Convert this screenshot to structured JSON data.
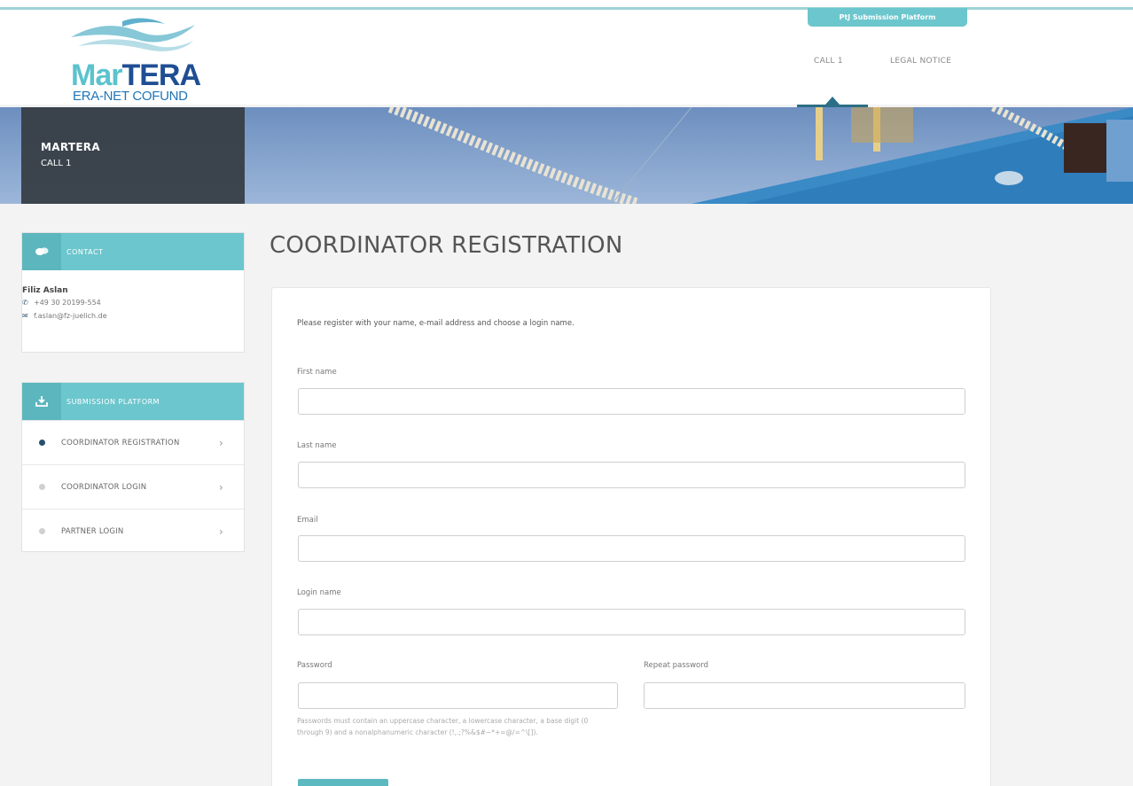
{
  "header": {
    "logo": {
      "brand_first": "Mar",
      "brand_second": "TERA",
      "subtitle": "ERA-NET COFUND"
    },
    "platform_tab": "PtJ Submission Platform",
    "nav": [
      {
        "label": "CALL 1"
      },
      {
        "label": "LEGAL NOTICE"
      }
    ]
  },
  "banner": {
    "title": "MARTERA",
    "subtitle": "CALL 1"
  },
  "sidebar": {
    "contact": {
      "heading": "CONTACT",
      "name": "Filiz Aslan",
      "phone": "+49 30 20199-554",
      "email": "f.aslan@fz-juelich.de",
      "icons": {
        "header": "chat-bubbles-icon",
        "phone": "phone-icon",
        "email": "envelope-icon"
      }
    },
    "submission": {
      "heading": "SUBMISSION PLATFORM",
      "icon": "download-tray-icon",
      "items": [
        {
          "label": "COORDINATOR REGISTRATION",
          "active": true
        },
        {
          "label": "COORDINATOR LOGIN",
          "active": false
        },
        {
          "label": "PARTNER LOGIN",
          "active": false
        }
      ]
    }
  },
  "main": {
    "title": "COORDINATOR REGISTRATION",
    "intro": "Please register with your name, e-mail address and choose a login name.",
    "fields": {
      "first_name": {
        "label": "First name",
        "value": ""
      },
      "last_name": {
        "label": "Last name",
        "value": ""
      },
      "email": {
        "label": "Email",
        "value": ""
      },
      "login_name": {
        "label": "Login name",
        "value": ""
      },
      "password": {
        "label": "Password",
        "value": ""
      },
      "repeat_password": {
        "label": "Repeat password",
        "value": ""
      }
    },
    "password_hint": "Passwords must contain an uppercase character, a lowercase character, a base digit (0 through 9) and a nonalphanumeric character (!,.;?%&$#~*+=@/=^\\[]).",
    "submit_label": ""
  },
  "colors": {
    "accent": "#6cc6cd",
    "accent_dark": "#2b6f86",
    "brand_light": "#5bc3cd",
    "brand_dark": "#1f4e93",
    "banner_label_bg": "#373e46",
    "page_bg": "#f3f3f3"
  }
}
